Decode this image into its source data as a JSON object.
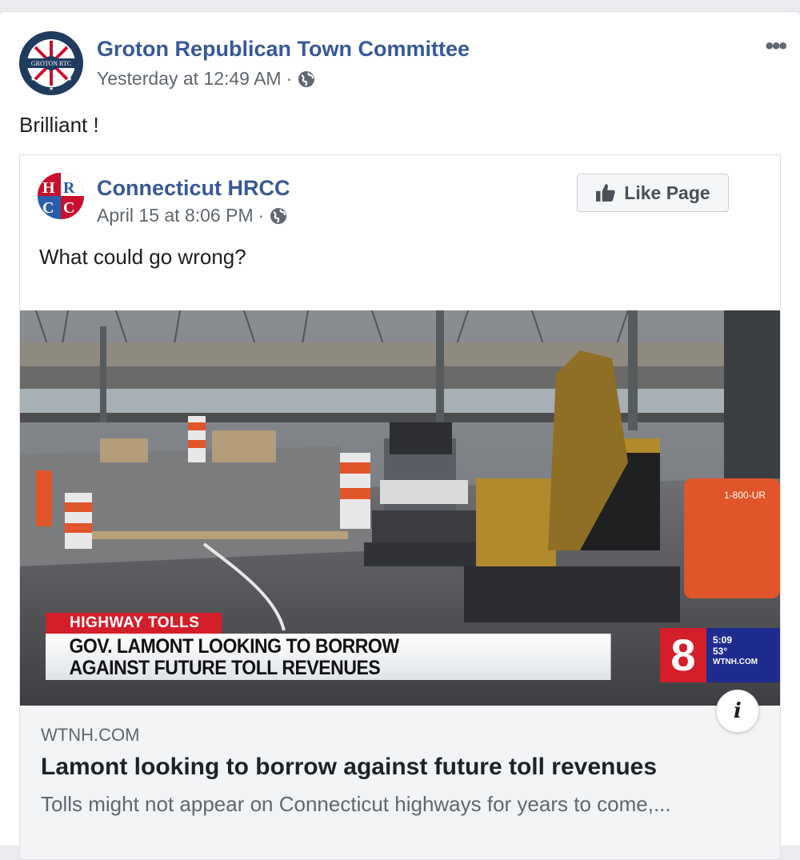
{
  "post": {
    "author": "Groton Republican Town Committee",
    "avatar_text": "GROTON RTC",
    "timestamp": "Yesterday at 12:49 AM",
    "separator": "·",
    "privacy_icon": "globe-icon",
    "more_icon": "more-options-icon",
    "more_label": "•••",
    "text": "Brilliant !"
  },
  "shared": {
    "author": "Connecticut HRCC",
    "avatar_text": "HRCC",
    "timestamp": "April 15 at 8:06 PM",
    "separator": "·",
    "privacy_icon": "globe-icon",
    "like_button": "Like Page",
    "text": "What could go wrong?"
  },
  "media": {
    "chyron_tag": "HIGHWAY TOLLS",
    "chyron_line1": "GOV. LAMONT LOOKING TO BORROW",
    "chyron_line2": "AGAINST FUTURE TOLL REVENUES",
    "channel_number": "8",
    "channel_time": "5:09",
    "channel_temp": "53°",
    "channel_site": "WTNH.COM",
    "info_label": "i"
  },
  "link": {
    "domain": "WTNH.COM",
    "title": "Lamont looking to borrow against future toll revenues",
    "description": "Tolls might not appear on Connecticut highways for years to come,..."
  },
  "colors": {
    "link_blue": "#385898",
    "secondary_gray": "#606770",
    "chyron_red": "#d41f2a",
    "channel_blue": "#1d2c8e"
  }
}
